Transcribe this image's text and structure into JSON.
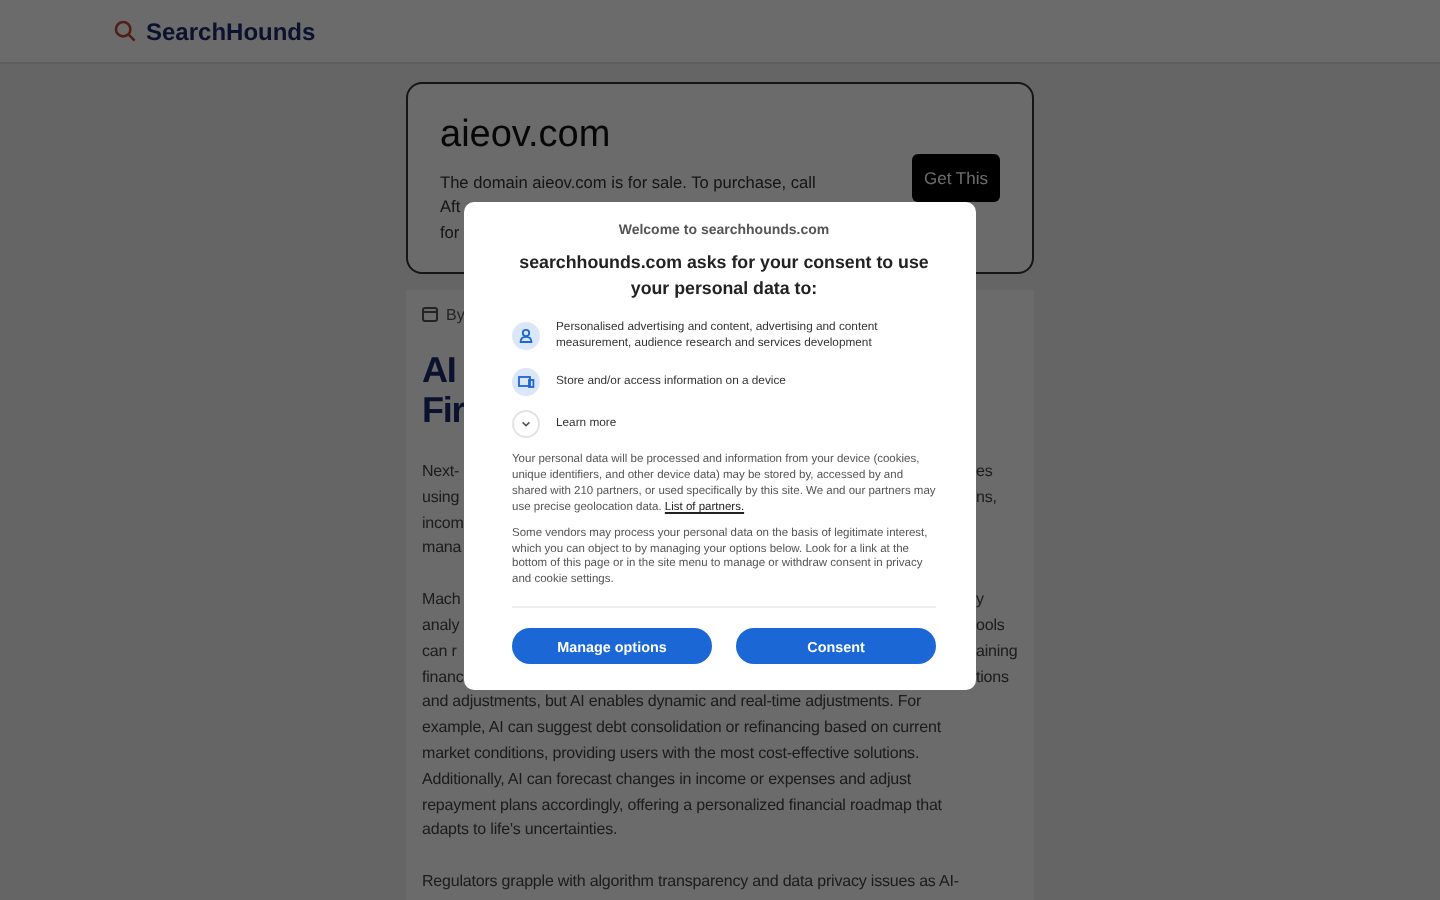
{
  "header": {
    "logo": "SearchHounds"
  },
  "domain_card": {
    "title": "aieov.com",
    "lines": [
      "The domain aieov.com is for sale. To purchase, call",
      "Aft",
      "for"
    ],
    "button": "Get This"
  },
  "article": {
    "meta": "By",
    "title_lines": [
      "AI",
      "Fir"
    ],
    "paragraphs": [
      {
        "lines": [
          {
            "left": "Next-",
            "right": "es"
          },
          {
            "left": "using",
            "right": "ns,"
          },
          {
            "left": "incom"
          },
          {
            "left": "mana"
          }
        ]
      },
      {
        "lines": [
          {
            "left": "Mach",
            "right": "y"
          },
          {
            "left": "analy",
            "right": "ools"
          },
          {
            "left": "can r",
            "right": "aining"
          },
          {
            "left": "financ",
            "right": "tions"
          },
          {
            "left": "and adjustments, but AI enables dynamic and real-time adjustments. For"
          },
          {
            "left": "example, AI can suggest debt consolidation or refinancing based on current"
          },
          {
            "left": "market conditions, providing users with the most cost-effective solutions."
          },
          {
            "left": "Additionally, AI can forecast changes in income or expenses and adjust"
          },
          {
            "left": "repayment plans accordingly, offering a personalized financial roadmap that"
          },
          {
            "left": "adapts to life's uncertainties."
          }
        ]
      },
      {
        "lines": [
          {
            "left": "Regulators grapple with algorithm transparency and data privacy issues as AI-"
          }
        ]
      }
    ]
  },
  "consent": {
    "welcome": "Welcome to searchhounds.com",
    "heading": "searchhounds.com asks for your consent to use your personal data to:",
    "purposes": [
      {
        "kind": "person",
        "text": "Personalised advertising and content, advertising and content measurement, audience research and services development"
      },
      {
        "kind": "device",
        "text": "Store and/or access information on a device"
      }
    ],
    "learn_more": {
      "label": "Learn more",
      "expanded": false
    },
    "paragraphs": [
      {
        "text": "Your personal data will be processed and information from your device (cookies, unique identifiers, and other device data) may be stored by, accessed by and shared with 210 partners, or used specifically by this site. We and our partners may use precise geolocation data.",
        "link": "List of partners."
      },
      {
        "text": "Some vendors may process your personal data on the basis of legitimate interest, which you can object to by managing your options below. Look for a link at the bottom of this page or in the site menu to manage or withdraw consent in privacy and cookie settings."
      }
    ],
    "buttons": [
      "Manage options",
      "Consent"
    ]
  }
}
